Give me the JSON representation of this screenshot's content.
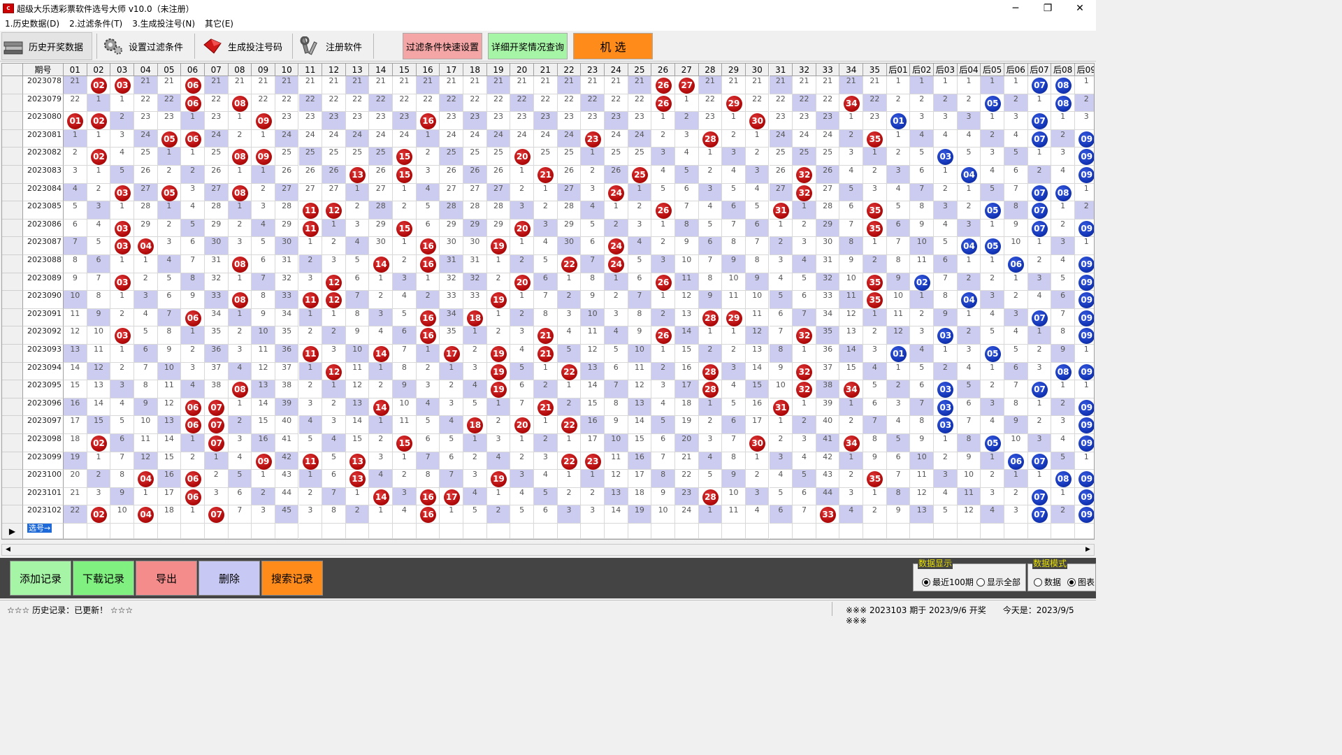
{
  "window": {
    "title": "超级大乐透彩票软件选号大师 v10.0（未注册）",
    "icon": "app-icon",
    "minimize": "─",
    "restore": "❐",
    "close": "✕"
  },
  "menu": [
    "1.历史数据(D)",
    "2.过滤条件(T)",
    "3.生成投注号(N)",
    "其它(E)"
  ],
  "toolbar": {
    "history": "历史开奖数据",
    "filter": "设置过滤条件",
    "generate": "生成投注号码",
    "register": "注册软件",
    "quick_filter": "过滤条件快速设置",
    "draw_detail": "详细开奖情况查询",
    "random_pick": "机 选",
    "colors": {
      "quick_filter": "#f4a6a6",
      "draw_detail": "#a6f4a6",
      "random_pick": "#ff8c1a"
    }
  },
  "grid": {
    "period_header": "期号",
    "front_headers": [
      "01",
      "02",
      "03",
      "04",
      "05",
      "06",
      "07",
      "08",
      "09",
      "10",
      "11",
      "12",
      "13",
      "14",
      "15",
      "16",
      "17",
      "18",
      "19",
      "20",
      "21",
      "22",
      "23",
      "24",
      "25",
      "26",
      "27",
      "28",
      "29",
      "30",
      "31",
      "32",
      "33",
      "34",
      "35"
    ],
    "back_headers": [
      "后01",
      "后02",
      "后03",
      "后04",
      "后05",
      "后06",
      "后07",
      "后08",
      "后09"
    ],
    "select_label": "选号→",
    "rows": [
      {
        "period": "2023078",
        "front": [
          2,
          3,
          6,
          26,
          27
        ],
        "back": [
          7,
          8
        ]
      },
      {
        "period": "2023079",
        "front": [
          6,
          8,
          26,
          29,
          34
        ],
        "back": [
          5,
          8
        ]
      },
      {
        "period": "2023080",
        "front": [
          1,
          2,
          9,
          16,
          30
        ],
        "back": [
          1,
          7
        ]
      },
      {
        "period": "2023081",
        "front": [
          5,
          6,
          23,
          28,
          35
        ],
        "back": [
          7,
          9
        ]
      },
      {
        "period": "2023082",
        "front": [
          2,
          8,
          9,
          15,
          20
        ],
        "back": [
          3,
          9
        ]
      },
      {
        "period": "2023083",
        "front": [
          13,
          15,
          21,
          25,
          32
        ],
        "back": [
          4,
          9
        ]
      },
      {
        "period": "2023084",
        "front": [
          3,
          5,
          8,
          24,
          32
        ],
        "back": [
          7,
          8
        ]
      },
      {
        "period": "2023085",
        "front": [
          11,
          12,
          26,
          31,
          35
        ],
        "back": [
          5,
          7
        ]
      },
      {
        "period": "2023086",
        "front": [
          3,
          11,
          15,
          20,
          35
        ],
        "back": [
          7,
          9
        ]
      },
      {
        "period": "2023087",
        "front": [
          3,
          4,
          16,
          19,
          24
        ],
        "back": [
          4,
          5
        ]
      },
      {
        "period": "2023088",
        "front": [
          8,
          14,
          16,
          22,
          24
        ],
        "back": [
          6,
          9
        ]
      },
      {
        "period": "2023089",
        "front": [
          3,
          12,
          20,
          26,
          35
        ],
        "back": [
          2,
          9
        ]
      },
      {
        "period": "2023090",
        "front": [
          8,
          11,
          12,
          19,
          35
        ],
        "back": [
          4,
          9
        ]
      },
      {
        "period": "2023091",
        "front": [
          6,
          16,
          18,
          28,
          29
        ],
        "back": [
          7,
          9
        ]
      },
      {
        "period": "2023092",
        "front": [
          3,
          16,
          21,
          26,
          32
        ],
        "back": [
          3,
          9
        ]
      },
      {
        "period": "2023093",
        "front": [
          11,
          14,
          17,
          19,
          21
        ],
        "back": [
          1,
          5
        ]
      },
      {
        "period": "2023094",
        "front": [
          12,
          19,
          22,
          28,
          32
        ],
        "back": [
          8,
          9
        ]
      },
      {
        "period": "2023095",
        "front": [
          8,
          19,
          28,
          32,
          34
        ],
        "back": [
          3,
          7
        ]
      },
      {
        "period": "2023096",
        "front": [
          6,
          7,
          14,
          21,
          31
        ],
        "back": [
          3,
          9
        ]
      },
      {
        "period": "2023097",
        "front": [
          6,
          7,
          18,
          20,
          22
        ],
        "back": [
          3,
          9
        ]
      },
      {
        "period": "2023098",
        "front": [
          2,
          7,
          15,
          30,
          34
        ],
        "back": [
          5,
          9
        ]
      },
      {
        "period": "2023099",
        "front": [
          9,
          11,
          13,
          22,
          23
        ],
        "back": [
          6,
          7
        ]
      },
      {
        "period": "2023100",
        "front": [
          4,
          6,
          13,
          19,
          35
        ],
        "back": [
          8,
          9
        ]
      },
      {
        "period": "2023101",
        "front": [
          6,
          14,
          16,
          17,
          28
        ],
        "back": [
          7,
          9
        ]
      },
      {
        "period": "2023102",
        "front": [
          2,
          4,
          7,
          16,
          33
        ],
        "back": [
          7,
          9
        ]
      }
    ],
    "colors": {
      "red": "#c01010",
      "blue": "#1436b8",
      "shade": "#ccccf0"
    }
  },
  "buttons": {
    "add": "添加记录",
    "download": "下载记录",
    "export": "导出",
    "delete": "删除",
    "search": "搜索记录",
    "colors": {
      "add": "#a6f4a6",
      "download": "#80f080",
      "export": "#f48c8c",
      "delete": "#c8c8f4",
      "search": "#ff8c1a"
    }
  },
  "data_display": {
    "label": "数据显示",
    "recent": "最近100期",
    "all": "显示全部",
    "selected": "recent"
  },
  "data_mode": {
    "label": "数据模式",
    "data": "数据",
    "chart": "图表",
    "selected": "chart"
  },
  "status": {
    "left": "☆☆☆ 历史记录：已更新！ ☆☆☆",
    "right": "※※※ 2023103 期于 2023/9/6 开奖　　今天是：2023/9/5 ※※※"
  }
}
